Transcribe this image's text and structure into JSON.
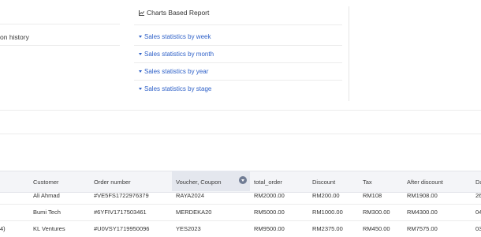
{
  "left_panel": {
    "history_label": "on history"
  },
  "reports": {
    "title": "Charts Based Report",
    "title_icon": "chart-icon",
    "items": [
      {
        "label": "Sales statistics by week"
      },
      {
        "label": "Sales statistics by month"
      },
      {
        "label": "Sales statistics by year"
      },
      {
        "label": "Sales statistics by stage"
      }
    ]
  },
  "table": {
    "columns": [
      "Customer",
      "Order number",
      "Voucher, Coupon",
      "total_order",
      "Discount",
      "Tax",
      "After discount",
      "Da"
    ],
    "sorted_column": "Voucher, Coupon",
    "rows": [
      {
        "lead": "",
        "customer": "Ali Ahmad",
        "order_number": "#VE5FS1722976379",
        "voucher": "RAYA2024",
        "total_order": "RM2000.00",
        "discount": "RM200.00",
        "tax": "RM108",
        "after_discount": "RM1908.00",
        "date": "26"
      },
      {
        "lead": "",
        "customer": "Bumi Tech",
        "order_number": "#6YFIV1717503461",
        "voucher": "MERDEKA20",
        "total_order": "RM5000.00",
        "discount": "RM1000.00",
        "tax": "RM300.00",
        "after_discount": "RM4300.00",
        "date": "04"
      },
      {
        "lead": "4)",
        "customer": "KL Ventures",
        "order_number": "#U0VSY1719950096",
        "voucher": "YES2023",
        "total_order": "RM9500.00",
        "discount": "RM2375.00",
        "tax": "RM450.00",
        "after_discount": "RM7575.00",
        "date": "03"
      }
    ]
  }
}
